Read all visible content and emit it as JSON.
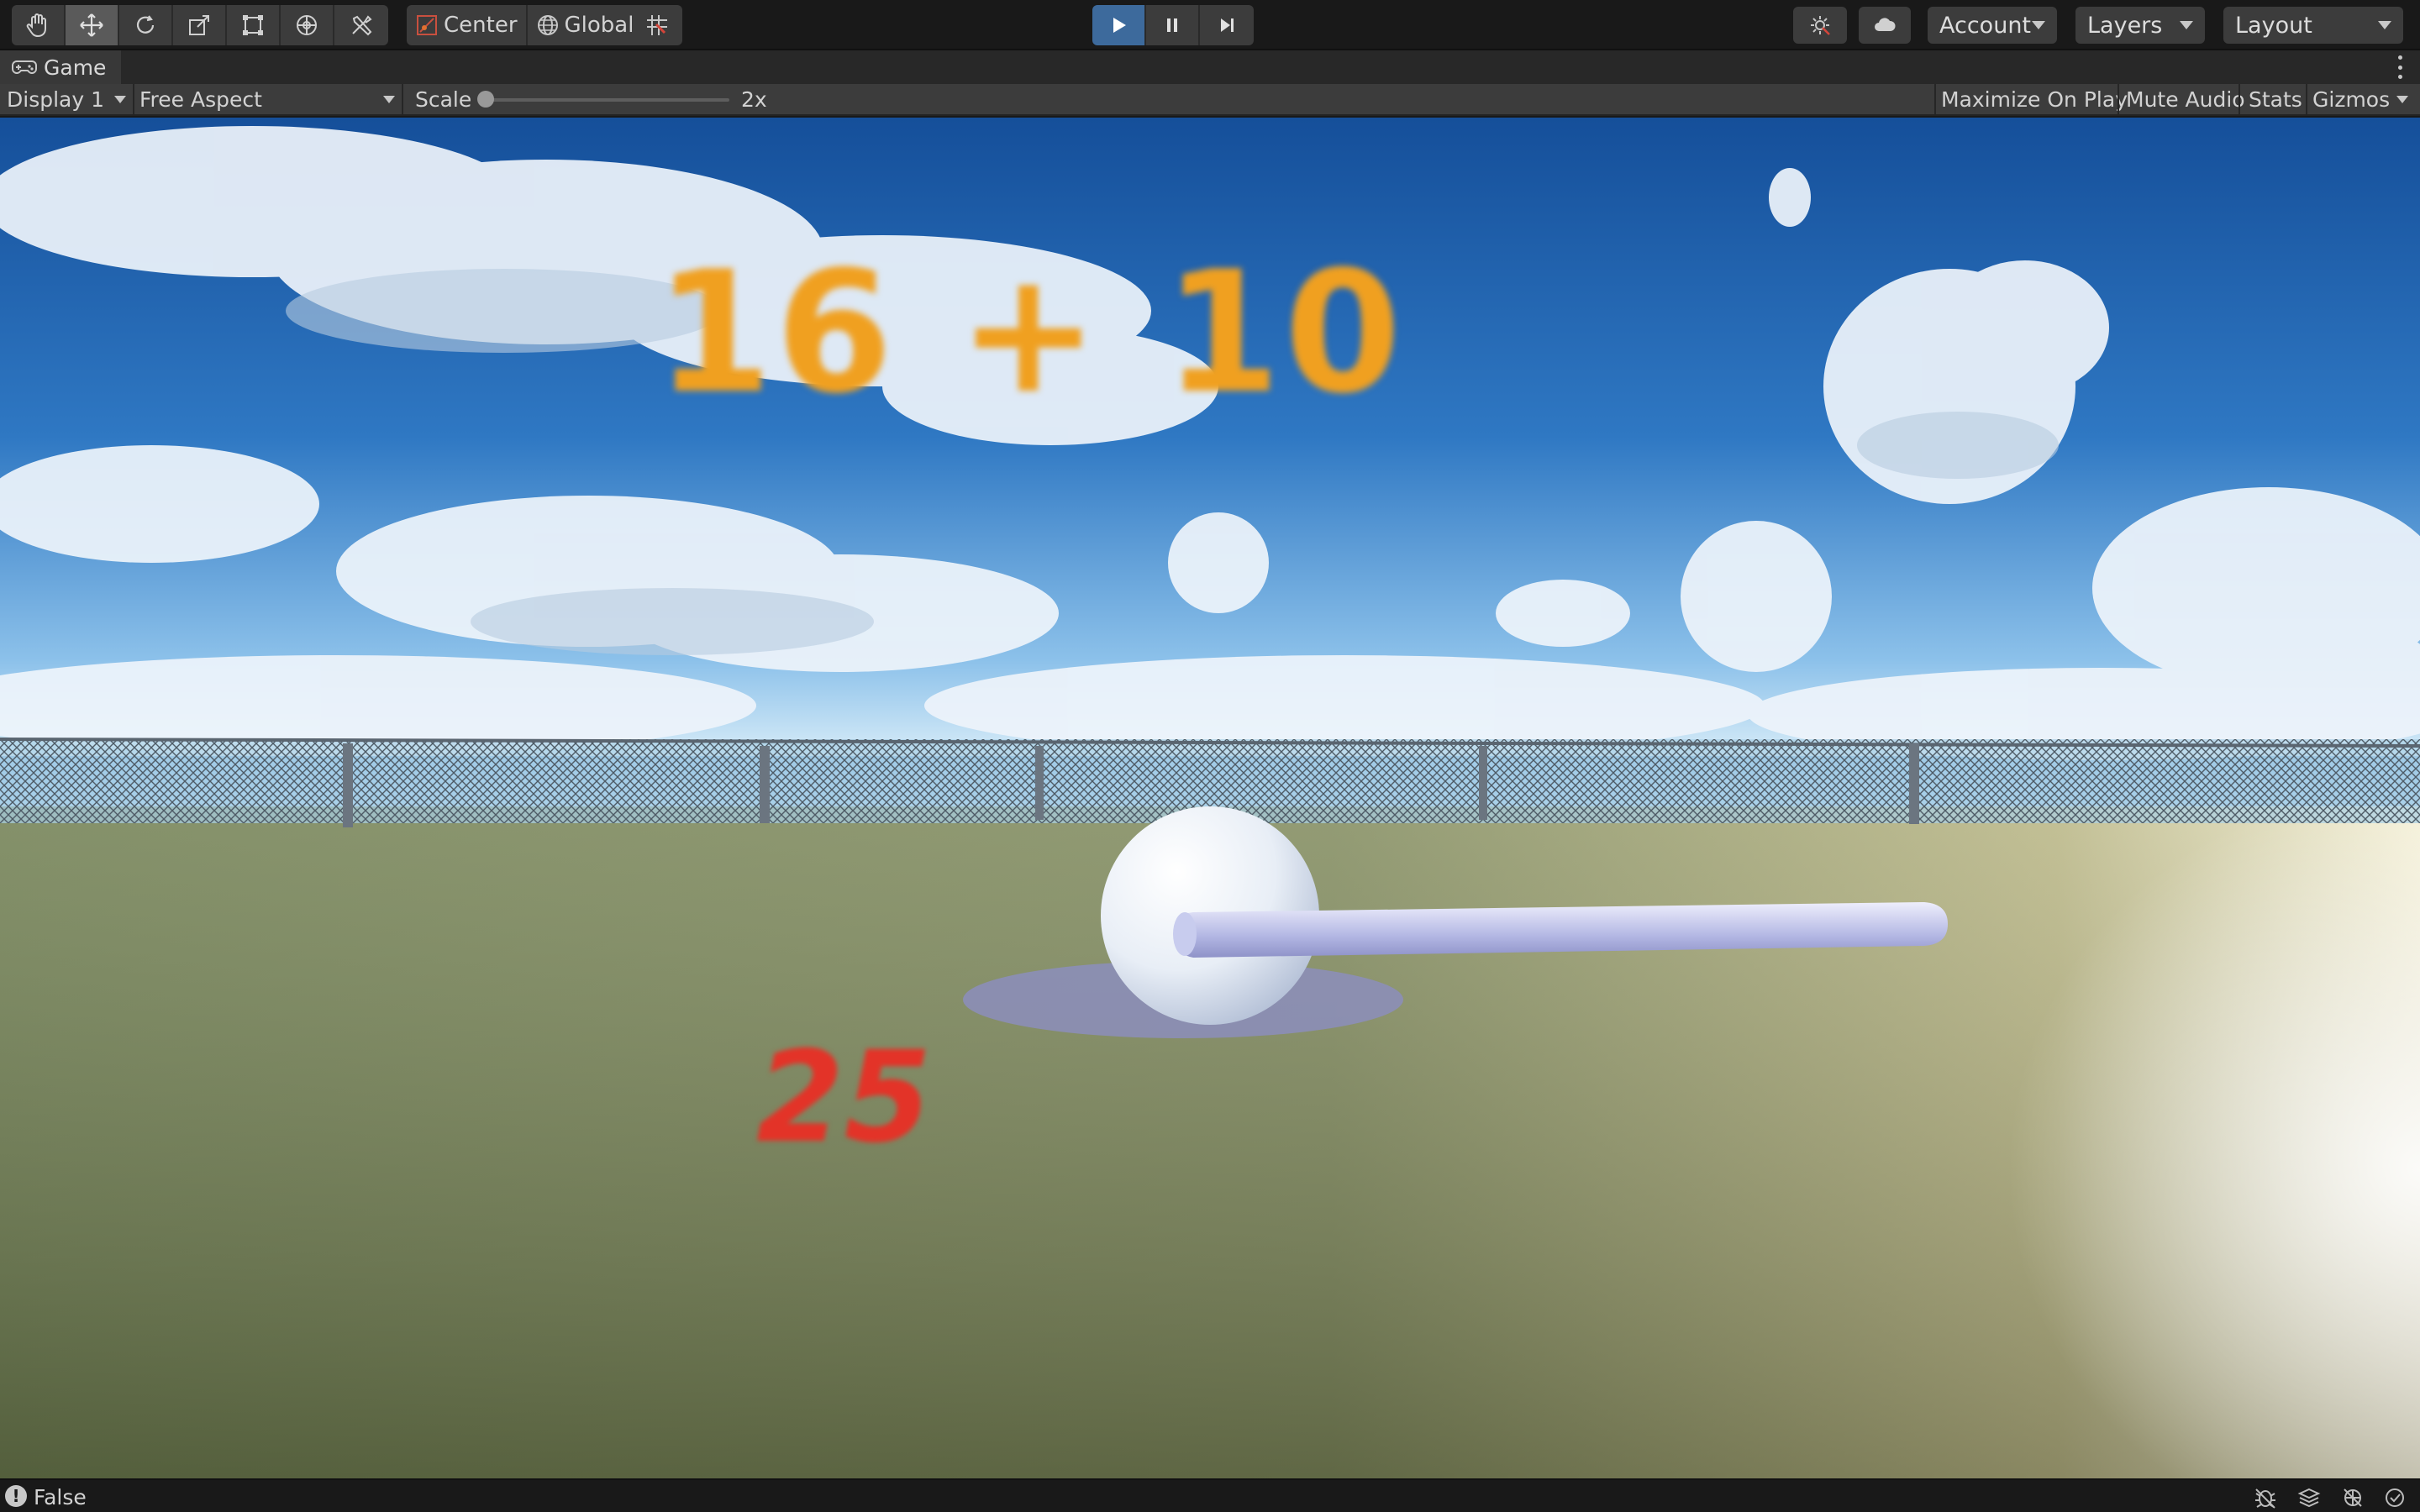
{
  "toolbar": {
    "tools": [
      "hand-icon",
      "move-icon",
      "rotate-icon",
      "scale-icon",
      "rect-icon",
      "transform-icon",
      "custom-tools-icon"
    ],
    "active_tool": "move-icon",
    "pivot_label": "Center",
    "space_label": "Global",
    "play_state": "playing",
    "account_label": "Account",
    "layers_label": "Layers",
    "layout_label": "Layout"
  },
  "tab": {
    "label": "Game"
  },
  "game_controls": {
    "display_label": "Display 1",
    "aspect_label": "Free Aspect",
    "scale_label": "Scale",
    "scale_value": "2x",
    "maximize_label": "Maximize On Play",
    "mute_label": "Mute Audio",
    "stats_label": "Stats",
    "gizmos_label": "Gizmos"
  },
  "game": {
    "equation": "16 + 10",
    "answer": "25",
    "colors": {
      "equation": "#f0a020",
      "answer": "#e33328",
      "sky_top": "#1f5ea8",
      "grass": "#7e8a5b"
    }
  },
  "status": {
    "text": "False"
  },
  "colors": {
    "play_active": "#3d6a9c",
    "panel": "#3c3c3c",
    "background": "#191919"
  }
}
